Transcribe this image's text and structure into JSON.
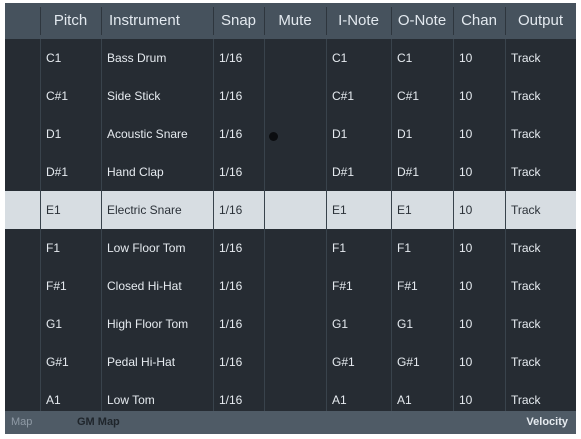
{
  "columns": [
    "Pitch",
    "Instrument",
    "Snap",
    "Mute",
    "I-Note",
    "O-Note",
    "Chan",
    "Output"
  ],
  "rows": [
    {
      "pitch": "C1",
      "instrument": "Bass Drum",
      "snap": "1/16",
      "mute": false,
      "inote": "C1",
      "onote": "C1",
      "chan": "10",
      "output": "Track"
    },
    {
      "pitch": "C#1",
      "instrument": "Side Stick",
      "snap": "1/16",
      "mute": false,
      "inote": "C#1",
      "onote": "C#1",
      "chan": "10",
      "output": "Track"
    },
    {
      "pitch": "D1",
      "instrument": "Acoustic Snare",
      "snap": "1/16",
      "mute": true,
      "inote": "D1",
      "onote": "D1",
      "chan": "10",
      "output": "Track"
    },
    {
      "pitch": "D#1",
      "instrument": "Hand Clap",
      "snap": "1/16",
      "mute": false,
      "inote": "D#1",
      "onote": "D#1",
      "chan": "10",
      "output": "Track"
    },
    {
      "pitch": "E1",
      "instrument": "Electric Snare",
      "snap": "1/16",
      "mute": false,
      "inote": "E1",
      "onote": "E1",
      "chan": "10",
      "output": "Track",
      "selected": true
    },
    {
      "pitch": "F1",
      "instrument": "Low Floor Tom",
      "snap": "1/16",
      "mute": false,
      "inote": "F1",
      "onote": "F1",
      "chan": "10",
      "output": "Track"
    },
    {
      "pitch": "F#1",
      "instrument": "Closed Hi-Hat",
      "snap": "1/16",
      "mute": false,
      "inote": "F#1",
      "onote": "F#1",
      "chan": "10",
      "output": "Track"
    },
    {
      "pitch": "G1",
      "instrument": "High Floor Tom",
      "snap": "1/16",
      "mute": false,
      "inote": "G1",
      "onote": "G1",
      "chan": "10",
      "output": "Track"
    },
    {
      "pitch": "G#1",
      "instrument": "Pedal Hi-Hat",
      "snap": "1/16",
      "mute": false,
      "inote": "G#1",
      "onote": "G#1",
      "chan": "10",
      "output": "Track"
    },
    {
      "pitch": "A1",
      "instrument": "Low Tom",
      "snap": "1/16",
      "mute": false,
      "inote": "A1",
      "onote": "A1",
      "chan": "10",
      "output": "Track"
    }
  ],
  "status": {
    "map_label": "Map",
    "map_value": "GM Map",
    "right_label": "Velocity"
  },
  "colors": {
    "background": "#262c33",
    "header": "#46525d",
    "selected_row": "#d7dde2",
    "status_bar": "#4f5b66"
  }
}
